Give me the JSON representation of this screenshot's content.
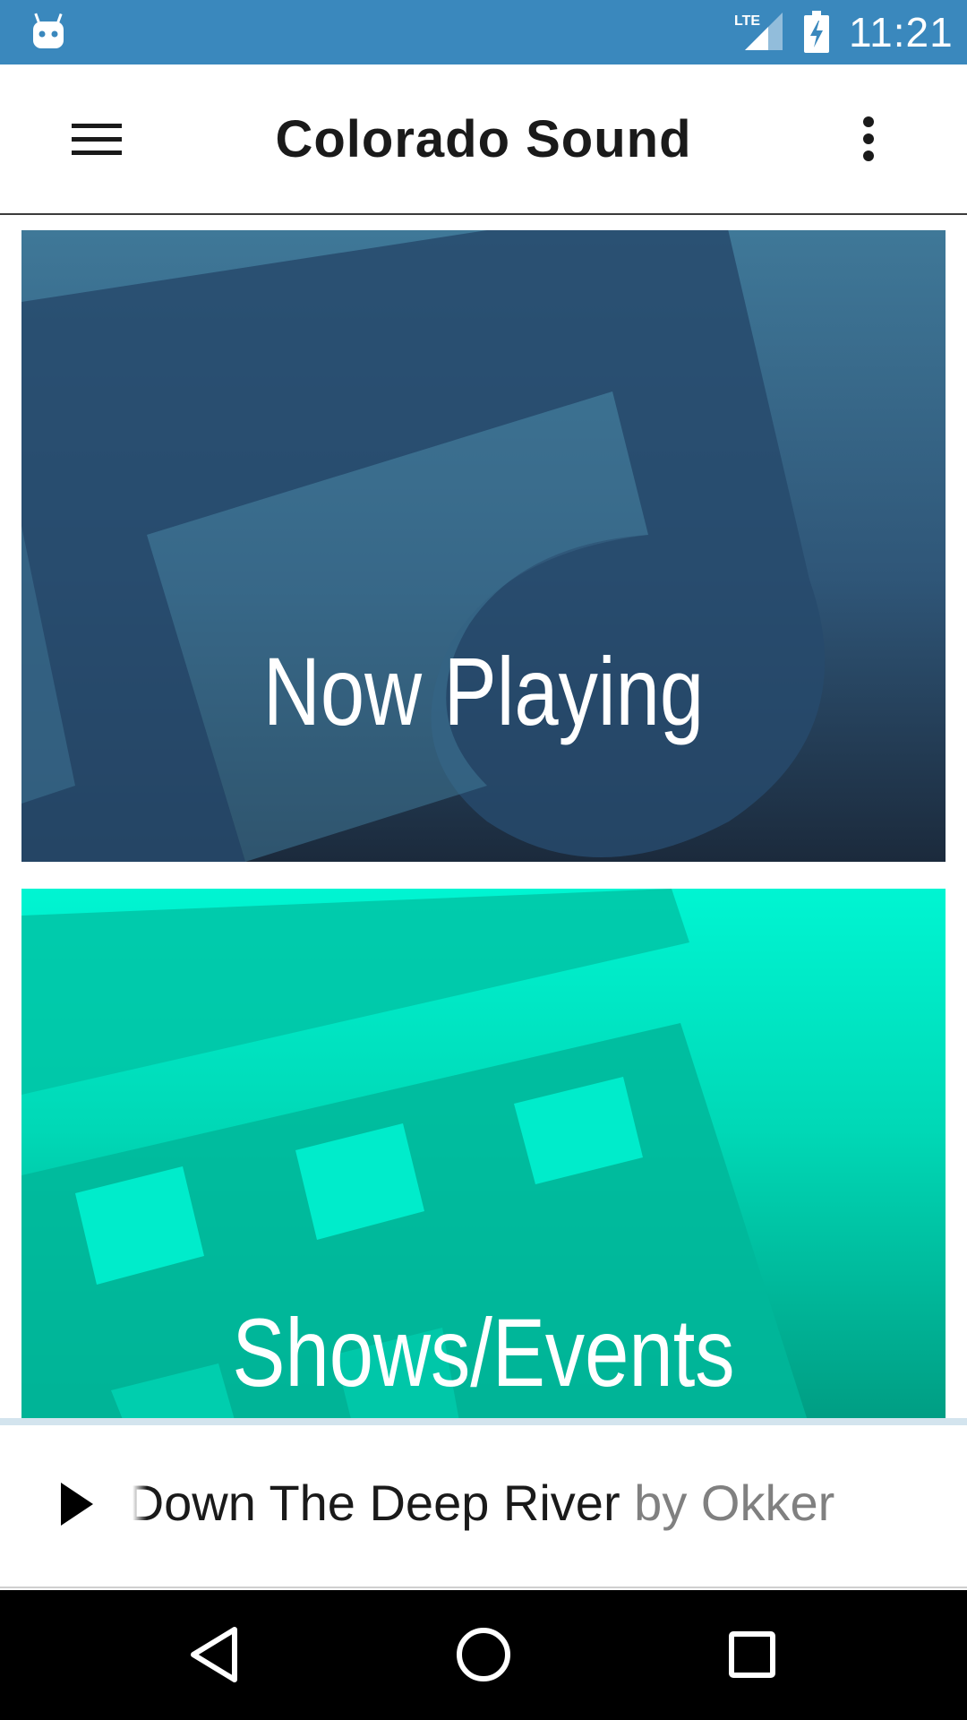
{
  "status_bar": {
    "time": "11:21",
    "network_label": "LTE",
    "icons": [
      "android-notification-icon",
      "lte-signal-icon",
      "battery-charging-icon"
    ]
  },
  "app_bar": {
    "title": "Colorado Sound",
    "menu_icon": "hamburger-menu-icon",
    "overflow_icon": "more-vert-icon"
  },
  "tiles": [
    {
      "label": "Now Playing",
      "icon": "music-note-icon",
      "color": "#2f5678"
    },
    {
      "label": "Shows/Events",
      "icon": "calendar-icon",
      "color": "#00d8b6"
    }
  ],
  "player": {
    "play_icon": "play-icon",
    "song": "Down The Deep River",
    "song_visible_prefix": "n",
    "by_text": "by",
    "artist": "Okker"
  },
  "nav_bar": {
    "icons": [
      "back-icon",
      "home-icon",
      "recents-icon"
    ]
  },
  "colors": {
    "status_bar": "#3a88bd",
    "now_playing_tile": "#2f5678",
    "shows_tile": "#00d8b6",
    "player_divider": "#d3e4ee"
  }
}
